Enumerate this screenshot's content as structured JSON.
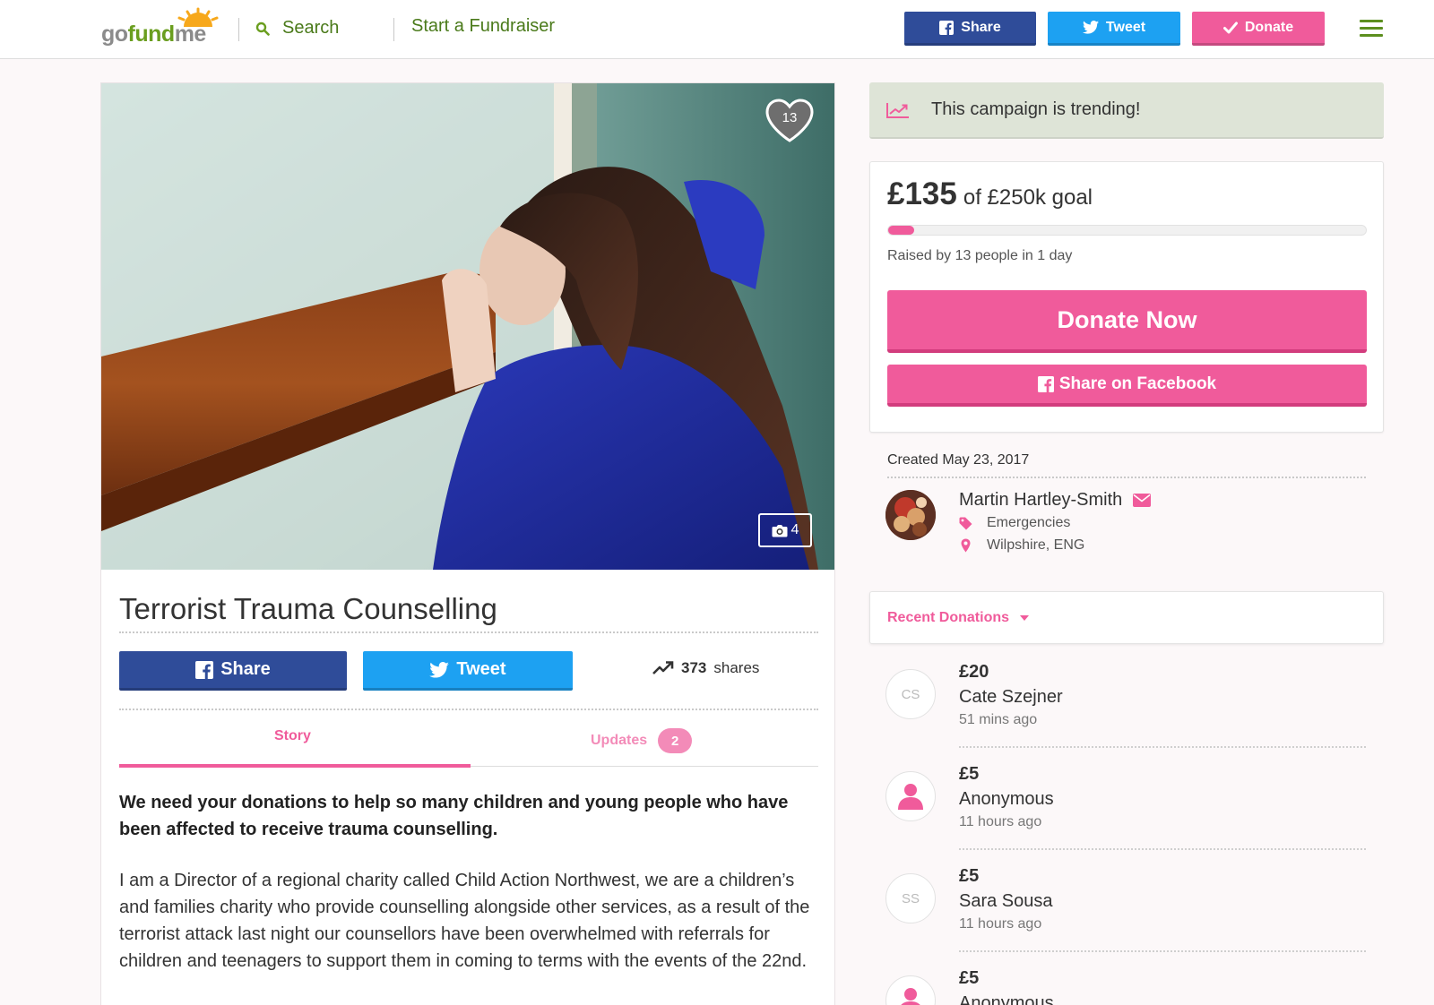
{
  "header": {
    "logo": "gofundme",
    "search_label": "Search",
    "start_label": "Start a Fundraiser",
    "share_label": "Share",
    "tweet_label": "Tweet",
    "donate_label": "Donate"
  },
  "campaign": {
    "heart_count": "13",
    "photo_count": "4",
    "title": "Terrorist Trauma Counselling",
    "share_label": "Share",
    "tweet_label": "Tweet",
    "shares_count": "373",
    "shares_suffix": "shares",
    "tabs": {
      "story": "Story",
      "updates": "Updates",
      "updates_badge": "2"
    },
    "lead": "We need your donations to help so many children and young people who have been affected to receive trauma counselling.",
    "body": "I am a Director of a regional charity called Child Action Northwest, we are a children’s and families charity who provide counselling alongside other services, as a result of the terrorist attack last night our counsellors have been overwhelmed with referrals for children and teenagers to support them in coming to terms with the events of the 22nd."
  },
  "sidebar": {
    "trending": "This campaign is trending!",
    "raised": "£135",
    "goal": "of £250k goal",
    "progress_percent": 0.054,
    "raised_by": "Raised by 13 people in 1 day",
    "donate_now": "Donate Now",
    "share_facebook": "Share on Facebook",
    "created": "Created May 23, 2017",
    "organizer": "Martin Hartley-Smith",
    "category": "Emergencies",
    "location": "Wilpshire, ENG",
    "recent_label": "Recent Donations",
    "donations": [
      {
        "initials": "CS",
        "amount": "£20",
        "name": "Cate Szejner",
        "time": "51 mins ago"
      },
      {
        "initials": "",
        "amount": "£5",
        "name": "Anonymous",
        "time": "11 hours ago"
      },
      {
        "initials": "SS",
        "amount": "£5",
        "name": "Sara Sousa",
        "time": "11 hours ago"
      },
      {
        "initials": "",
        "amount": "£5",
        "name": "Anonymous",
        "time": ""
      }
    ]
  },
  "colors": {
    "brand_green": "#6a9e1f",
    "facebook": "#2f4c99",
    "twitter": "#1da1f2",
    "pink": "#f05b9b"
  }
}
